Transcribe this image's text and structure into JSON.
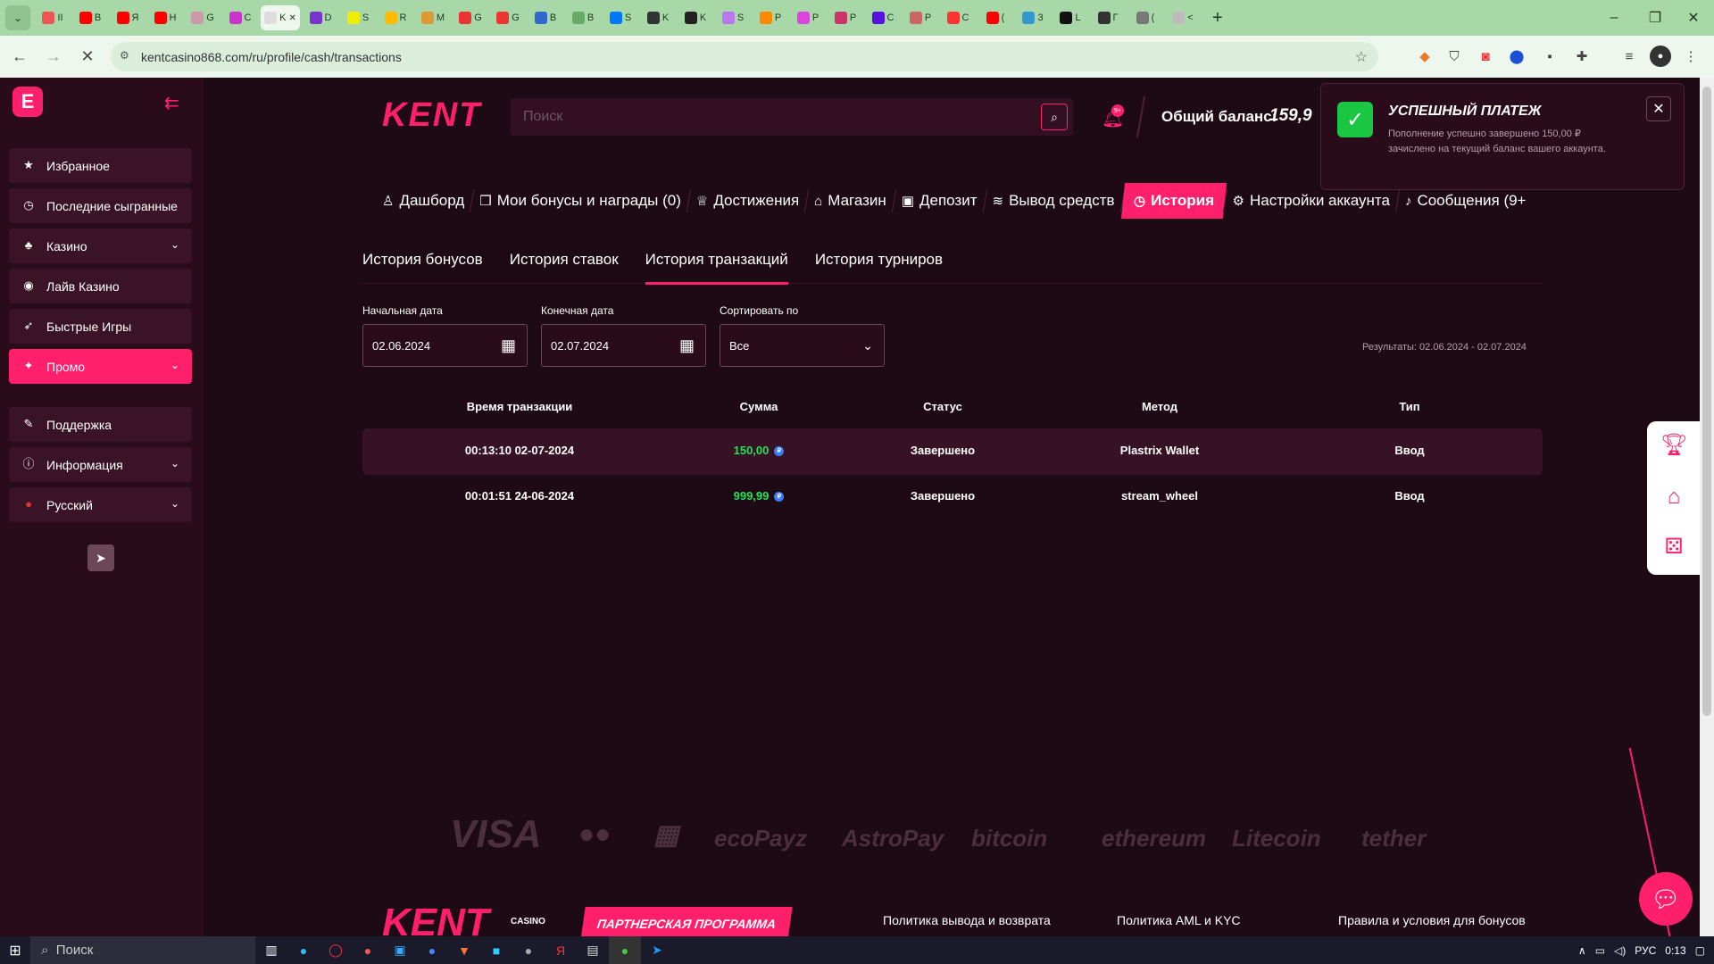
{
  "browser": {
    "tabs": [
      {
        "color": "#e55",
        "letter": "II"
      },
      {
        "color": "#f00",
        "letter": "B"
      },
      {
        "color": "#f00",
        "letter": "Я"
      },
      {
        "color": "#f00",
        "letter": "H"
      },
      {
        "color": "#c9a",
        "letter": "G"
      },
      {
        "color": "#c3c",
        "letter": "C"
      },
      {
        "color": "#ddd",
        "letter": "K",
        "active": true
      },
      {
        "color": "#73c",
        "letter": "D"
      },
      {
        "color": "#ee0",
        "letter": "S"
      },
      {
        "color": "#fb0",
        "letter": "R"
      },
      {
        "color": "#d93",
        "letter": "M"
      },
      {
        "color": "#e33",
        "letter": "G"
      },
      {
        "color": "#e33",
        "letter": "G"
      },
      {
        "color": "#36c",
        "letter": "B"
      },
      {
        "color": "#6a6",
        "letter": "B"
      },
      {
        "color": "#07f",
        "letter": "S"
      },
      {
        "color": "#333",
        "letter": "K"
      },
      {
        "color": "#222",
        "letter": "K"
      },
      {
        "color": "#b7e",
        "letter": "S"
      },
      {
        "color": "#f80",
        "letter": "P"
      },
      {
        "color": "#d4d",
        "letter": "P"
      },
      {
        "color": "#c36",
        "letter": "P"
      },
      {
        "color": "#51d",
        "letter": "C"
      },
      {
        "color": "#c66",
        "letter": "P"
      },
      {
        "color": "#f33",
        "letter": "C"
      },
      {
        "color": "#f00",
        "letter": "("
      },
      {
        "color": "#39c",
        "letter": "3"
      },
      {
        "color": "#111",
        "letter": "L"
      },
      {
        "color": "#333",
        "letter": "Г"
      },
      {
        "color": "#777",
        "letter": "("
      },
      {
        "color": "#bbb",
        "letter": "<"
      }
    ],
    "url": "kentcasino868.com/ru/profile/cash/transactions"
  },
  "sidebar": {
    "items": [
      {
        "label": "Избранное",
        "icon": "★",
        "chevron": false,
        "promo": false
      },
      {
        "label": "Последние сыгранные",
        "icon": "◷",
        "chevron": false,
        "promo": false
      },
      {
        "label": "Казино",
        "icon": "♣",
        "chevron": true,
        "promo": false
      },
      {
        "label": "Лайв Казино",
        "icon": "◉",
        "chevron": false,
        "promo": false
      },
      {
        "label": "Быстрые Игры",
        "icon": "➶",
        "chevron": false,
        "promo": false
      },
      {
        "label": "Промо",
        "icon": "✦",
        "chevron": true,
        "promo": true
      },
      {
        "label": "Поддержка",
        "icon": "✎",
        "chevron": false,
        "promo": false
      },
      {
        "label": "Информация",
        "icon": "ⓘ",
        "chevron": true,
        "promo": false
      },
      {
        "label": "Русский",
        "icon": "●",
        "chevron": true,
        "promo": false
      }
    ]
  },
  "header": {
    "brand": "KENT",
    "search_placeholder": "Поиск",
    "bell_badge": "9+",
    "balance_label": "Общий баланс:",
    "balance_value": "159,9"
  },
  "toast": {
    "title": "УСПЕШНЫЙ ПЛАТЕЖ",
    "text": "Пополнение успешно завершено 150,00 ₽ зачислено на текущий баланс вашего аккаунта."
  },
  "profile_nav": [
    {
      "label": "Дашборд",
      "icon": "♙",
      "active": false
    },
    {
      "label": "Мои бонусы и награды (0)",
      "icon": "❒",
      "active": false
    },
    {
      "label": "Достижения",
      "icon": "♕",
      "active": false
    },
    {
      "label": "Магазин",
      "icon": "⌂",
      "active": false
    },
    {
      "label": "Депозит",
      "icon": "▣",
      "active": false
    },
    {
      "label": "Вывод средств",
      "icon": "≋",
      "active": false
    },
    {
      "label": "История",
      "icon": "◷",
      "active": true
    },
    {
      "label": "Настройки аккаунта",
      "icon": "⚙",
      "active": false
    },
    {
      "label": "Сообщения (9+",
      "icon": "♪",
      "active": false
    }
  ],
  "subtabs": [
    {
      "label": "История бонусов",
      "active": false
    },
    {
      "label": "История ставок",
      "active": false
    },
    {
      "label": "История транзакций",
      "active": true
    },
    {
      "label": "История турниров",
      "active": false
    }
  ],
  "filters": {
    "start_label": "Начальная дата",
    "start_value": "02.06.2024",
    "end_label": "Конечная дата",
    "end_value": "02.07.2024",
    "sort_label": "Сортировать по",
    "sort_value": "Все",
    "results": "Результаты: 02.06.2024 - 02.07.2024"
  },
  "table": {
    "headers": [
      "Время транзакции",
      "Сумма",
      "Статус",
      "Метод",
      "Тип"
    ],
    "rows": [
      {
        "time": "00:13:10 02-07-2024",
        "amount": "150,00",
        "status": "Завершено",
        "method": "Plastrix Wallet",
        "type": "Ввод"
      },
      {
        "time": "00:01:51 24-06-2024",
        "amount": "999,99",
        "status": "Завершено",
        "method": "stream_wheel",
        "type": "Ввод"
      }
    ]
  },
  "payments": [
    "VISA",
    "●●",
    "▦",
    "ecoPayz",
    "AstroPay",
    "bitcoin",
    "ethereum",
    "Litecoin",
    "tether"
  ],
  "footer": {
    "brand": "KENT",
    "casino": "CASINO",
    "partner": "ПАРТНЕРСКАЯ ПРОГРАММА",
    "links": [
      "Политика вывода и возврата",
      "Политика AML и KYC",
      "Правила и условия для бонусов"
    ]
  },
  "taskbar": {
    "search": "Поиск",
    "lang": "РУС",
    "time": "0:13"
  },
  "colors": {
    "accent": "#ff1f6a",
    "success": "#1ac742",
    "amount": "#1ee65a"
  }
}
